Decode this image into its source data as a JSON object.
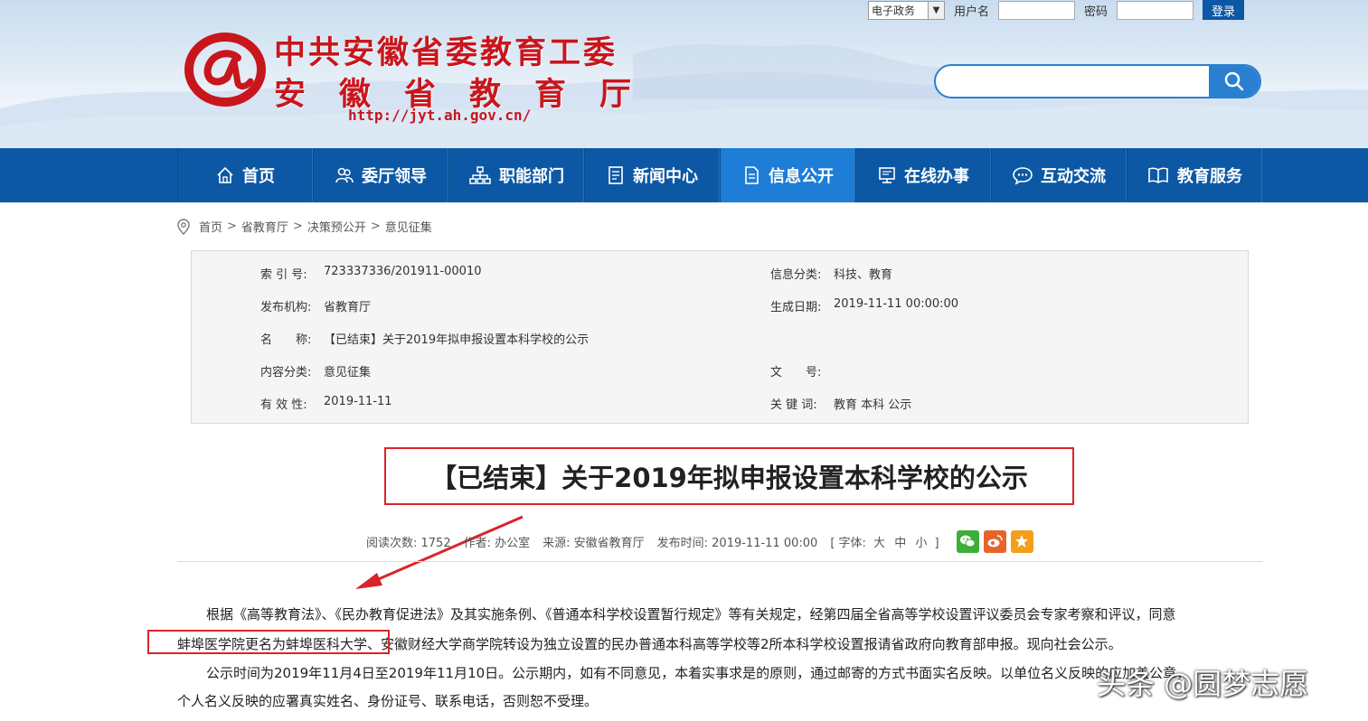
{
  "header": {
    "title_line1": "中共安徽省委教育工委",
    "title_line2": "安徽省教育厅",
    "url": "http://jyt.ah.gov.cn/",
    "login": {
      "system_select": "电子政务",
      "username_label": "用户名",
      "password_label": "密码",
      "login_button": "登录"
    },
    "search": {
      "placeholder": ""
    }
  },
  "nav": {
    "items": [
      {
        "label": "首页",
        "icon": "home-icon"
      },
      {
        "label": "委厅领导",
        "icon": "people-icon"
      },
      {
        "label": "职能部门",
        "icon": "org-chart-icon"
      },
      {
        "label": "新闻中心",
        "icon": "newspaper-icon"
      },
      {
        "label": "信息公开",
        "icon": "document-icon",
        "active": true
      },
      {
        "label": "在线办事",
        "icon": "computer-icon"
      },
      {
        "label": "互动交流",
        "icon": "chat-icon"
      },
      {
        "label": "教育服务",
        "icon": "book-icon"
      }
    ]
  },
  "breadcrumb": [
    "首页",
    "省教育厅",
    "决策预公开",
    "意见征集"
  ],
  "breadcrumb_sep": ">",
  "info": {
    "index_no_key": "索 引 号:",
    "index_no": "723337336/201911-00010",
    "category_key": "信息分类:",
    "category": "科技、教育",
    "publisher_key": "发布机构:",
    "publisher": "省教育厅",
    "created_key": "生成日期:",
    "created": "2019-11-11 00:00:00",
    "name_key": "名　　称:",
    "name": "【已结束】关于2019年拟申报设置本科学校的公示",
    "content_type_key": "内容分类:",
    "content_type": "意见征集",
    "doc_no_key": "文　　号:",
    "doc_no": "",
    "validity_key": "有 效 性:",
    "validity": "2019-11-11",
    "keywords_key": "关 键 词:",
    "keywords": "教育 本科 公示"
  },
  "article": {
    "title": "【已结束】关于2019年拟申报设置本科学校的公示",
    "meta": {
      "reads": "阅读次数: 1752",
      "author": "作者: 办公室",
      "source": "来源: 安徽省教育厅",
      "published": "发布时间: 2019-11-11 00:00",
      "font_prefix": "[ 字体:",
      "font_large": "大",
      "font_medium": "中",
      "font_small": "小",
      "font_suffix": "]"
    },
    "para1_line1": "根据《高等教育法》、《民办教育促进法》及其实施条例、《普通本科学校设置暂行规定》等有关规定，经第四届全省高等学校设置评议委员会专家考察和评议，同意",
    "para1_line2_highlight": "蚌埠医学院更名为蚌埠医科大学、",
    "para1_line2_rest": "安徽财经大学商学院转设为独立设置的民办普通本科高等学校等2所本科学校设置报请省政府向教育部申报。现向社会公示。",
    "para2_line1": "公示时间为2019年11月4日至2019年11月10日。公示期内，如有不同意见，本着实事求是的原则，通过邮寄的方式书面实名反映。以单位名义反映的应加盖公章，",
    "para2_line2": "个人名义反映的应署真实姓名、身份证号、联系电话，否则恕不受理。"
  },
  "watermark": "头条 @圆梦志愿",
  "colors": {
    "nav_bg": "#0d58a5",
    "nav_active": "#1e7dd6",
    "brand_red": "#c8161d",
    "annotation_red": "#d9242b"
  }
}
